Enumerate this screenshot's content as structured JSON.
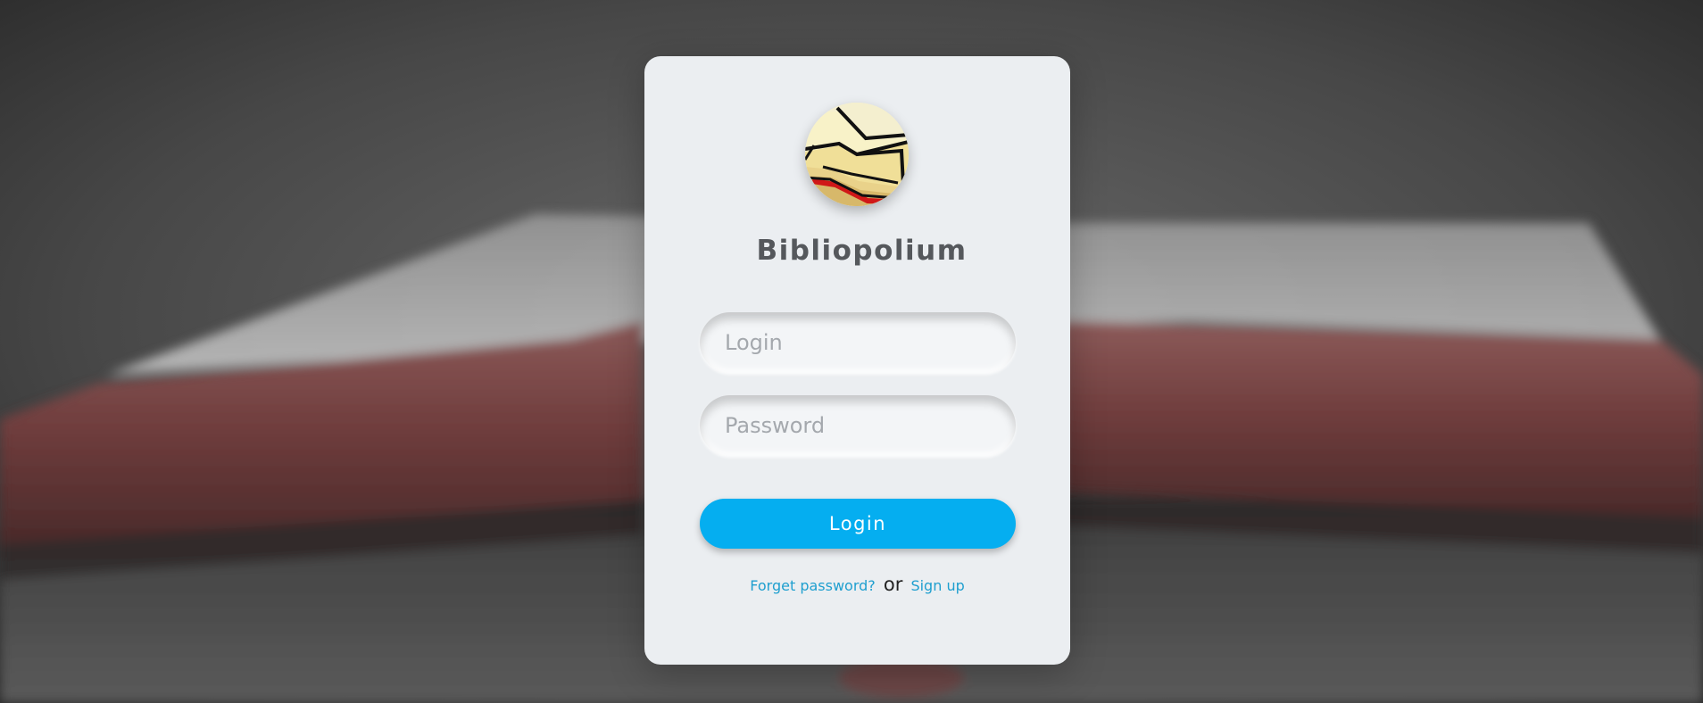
{
  "app": {
    "title": "Bibliopolium"
  },
  "form": {
    "login_placeholder": "Login",
    "password_placeholder": "Password",
    "login_value": "",
    "password_value": "",
    "submit_label": "Login"
  },
  "links": {
    "forget_password": "Forget password?",
    "separator": "or",
    "sign_up": "Sign up"
  },
  "colors": {
    "accent": "#05aef0",
    "link": "#1f9fcf",
    "card": "#ebeef1",
    "title": "#55585c"
  },
  "icons": {
    "logo": "open-book-logo-icon",
    "background": "open-book-background-image"
  }
}
